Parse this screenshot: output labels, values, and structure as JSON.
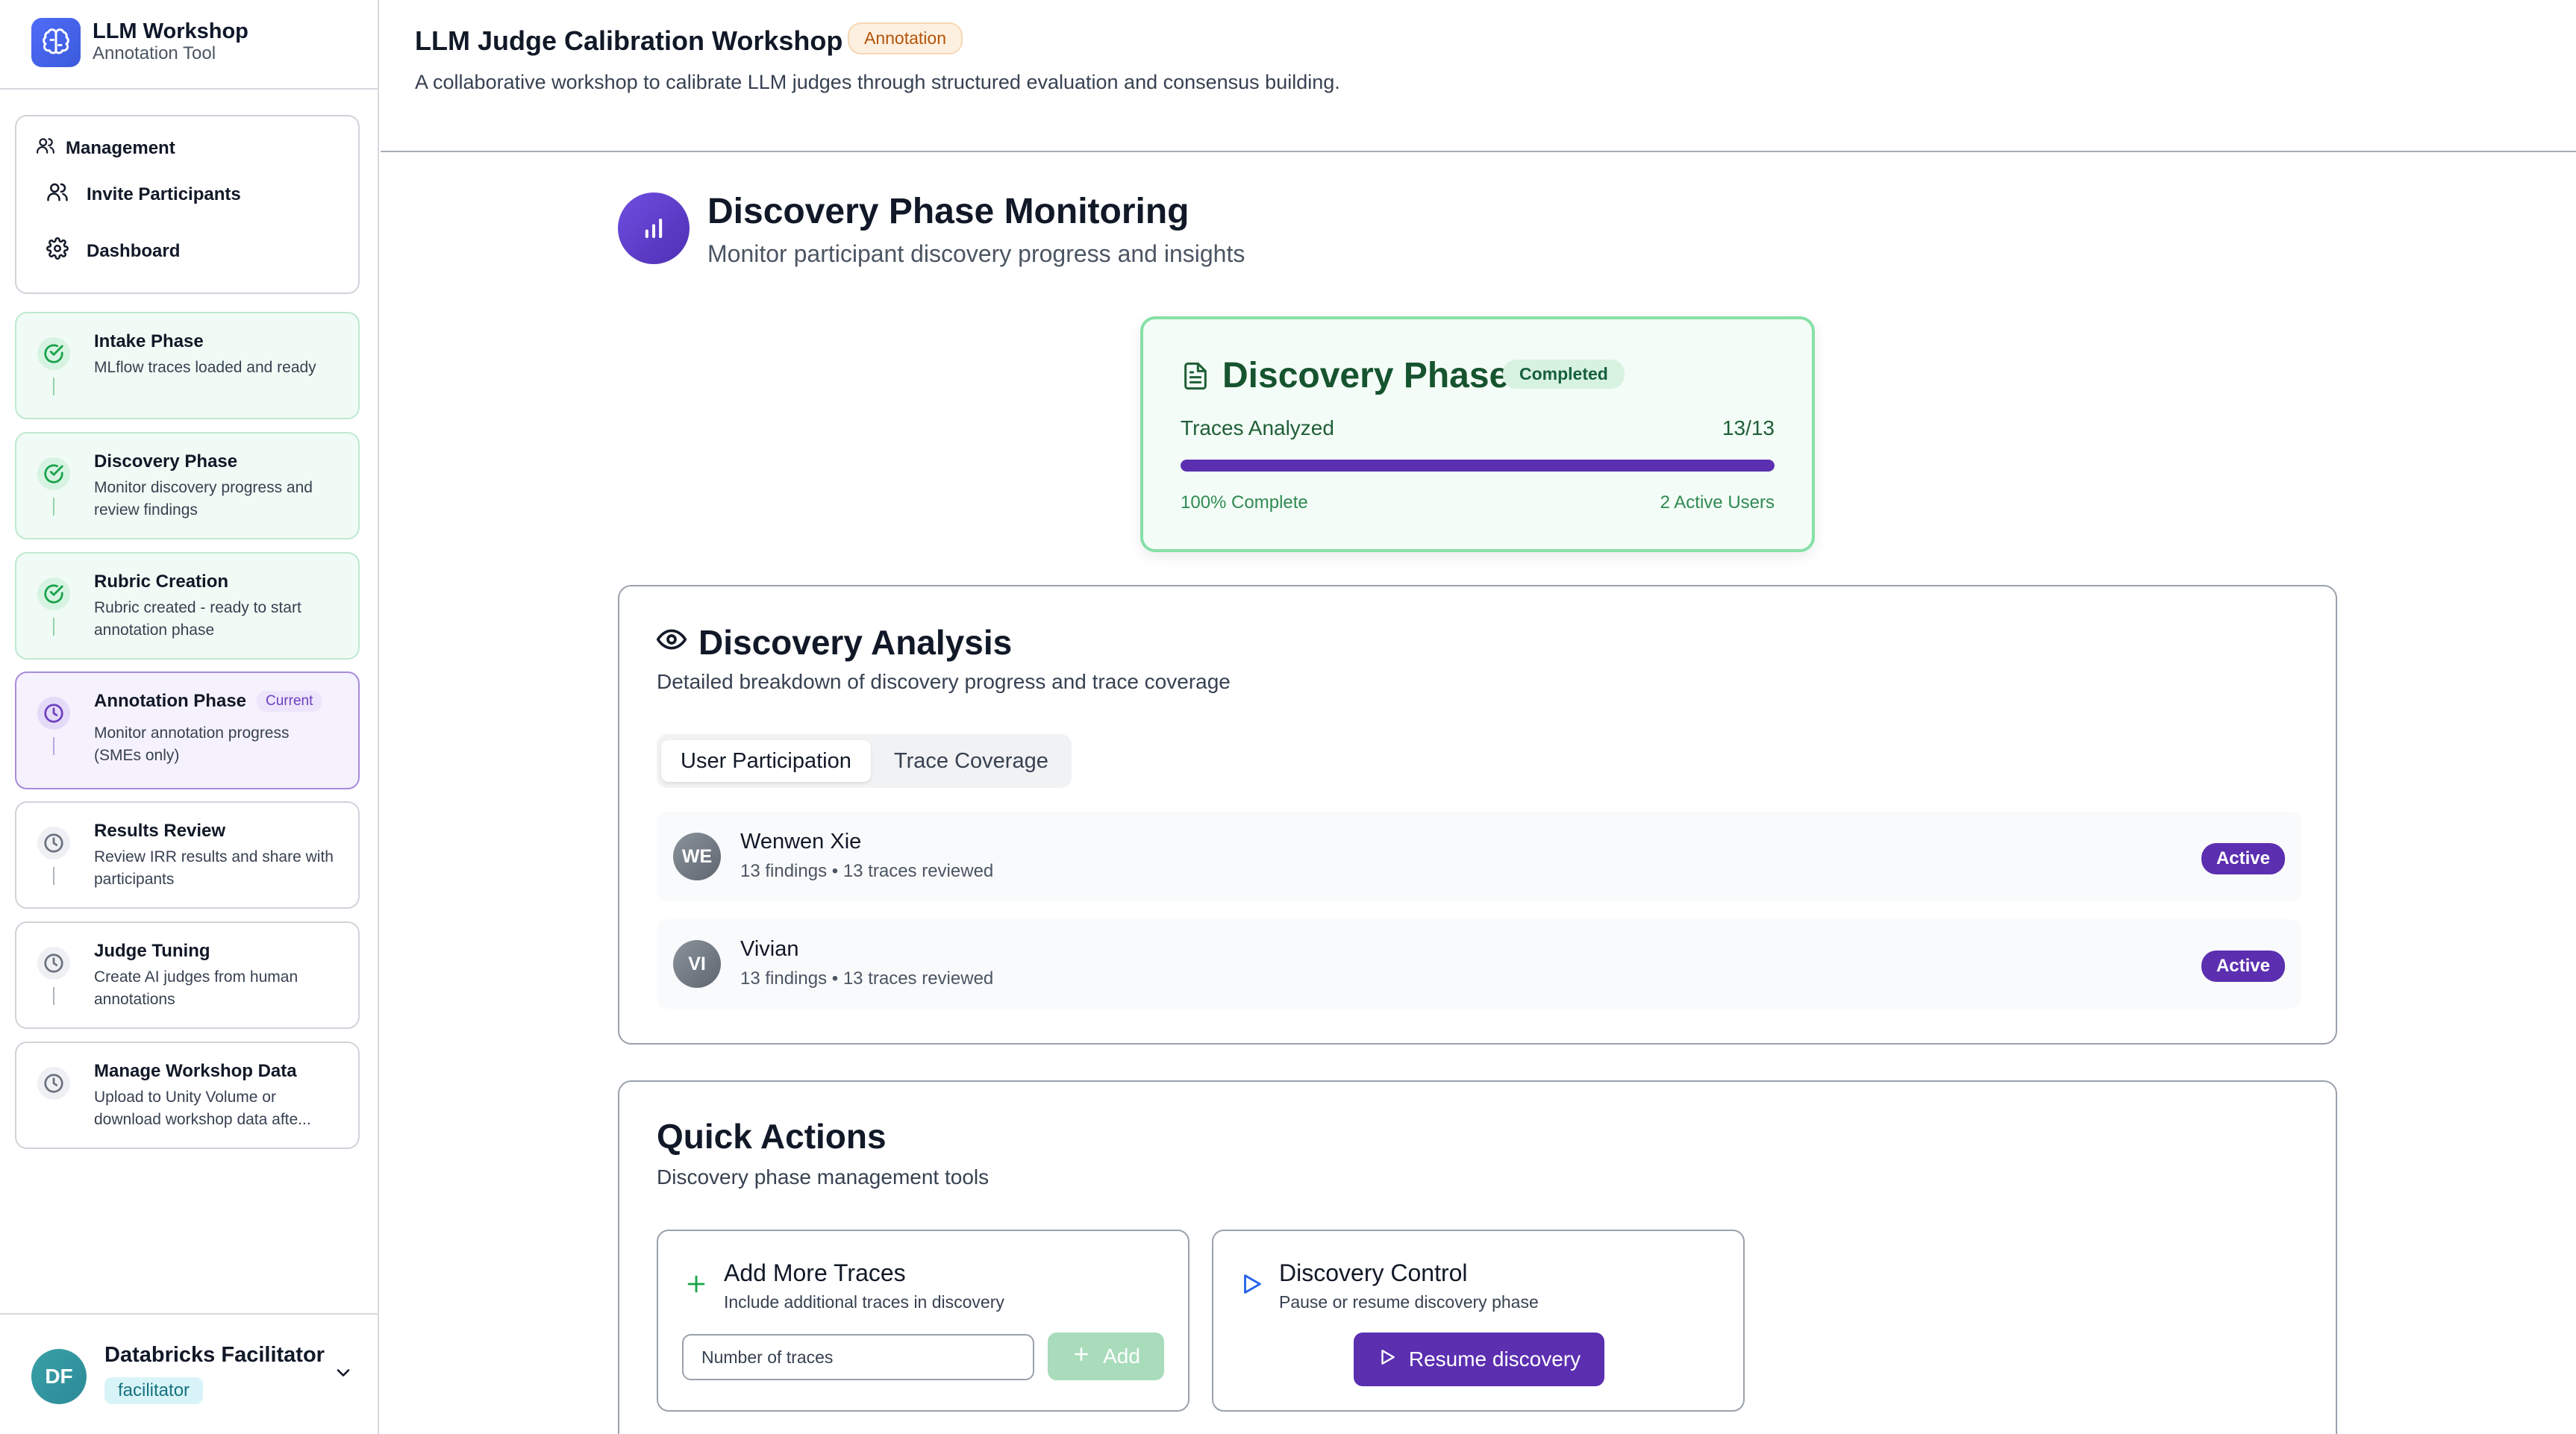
{
  "brand": {
    "title": "LLM Workshop",
    "subtitle": "Annotation Tool"
  },
  "management": {
    "heading": "Management",
    "items": [
      {
        "label": "Invite Participants",
        "icon": "users-icon"
      },
      {
        "label": "Dashboard",
        "icon": "gear-icon"
      }
    ]
  },
  "phases": [
    {
      "title": "Intake Phase",
      "desc": "MLflow traces loaded and ready",
      "status": "done"
    },
    {
      "title": "Discovery Phase",
      "desc": "Monitor discovery progress and review findings",
      "status": "done"
    },
    {
      "title": "Rubric Creation",
      "desc": "Rubric created - ready to start annotation phase",
      "status": "done"
    },
    {
      "title": "Annotation Phase",
      "badge": "Current",
      "desc": "Monitor annotation progress (SMEs only)",
      "status": "current"
    },
    {
      "title": "Results Review",
      "desc": "Review IRR results and share with participants",
      "status": "todo"
    },
    {
      "title": "Judge Tuning",
      "desc": "Create AI judges from human annotations",
      "status": "todo"
    },
    {
      "title": "Manage Workshop Data",
      "desc": "Upload to Unity Volume or download workshop data afte...",
      "status": "todo"
    }
  ],
  "user": {
    "initials": "DF",
    "name": "Databricks Facilitator",
    "role": "facilitator"
  },
  "header": {
    "title": "LLM Judge Calibration Workshop",
    "badge": "Annotation",
    "description": "A collaborative workshop to calibrate LLM judges through structured evaluation and consensus building."
  },
  "monitoring": {
    "title": "Discovery Phase Monitoring",
    "subtitle": "Monitor participant discovery progress and insights"
  },
  "discovery_card": {
    "title": "Discovery Phase",
    "badge": "Completed",
    "label": "Traces Analyzed",
    "count": "13/13",
    "progress": 1.0,
    "percent_text": "100% Complete",
    "active_users": "2 Active Users"
  },
  "analysis": {
    "title": "Discovery Analysis",
    "subtitle": "Detailed breakdown of discovery progress and trace coverage",
    "tabs": [
      {
        "label": "User Participation",
        "active": true
      },
      {
        "label": "Trace Coverage",
        "active": false
      }
    ],
    "users": [
      {
        "initials": "WE",
        "name": "Wenwen Xie",
        "stats": "13 findings • 13 traces reviewed",
        "status": "Active"
      },
      {
        "initials": "VI",
        "name": "Vivian",
        "stats": "13 findings • 13 traces reviewed",
        "status": "Active"
      }
    ]
  },
  "quick_actions": {
    "title": "Quick Actions",
    "subtitle": "Discovery phase management tools",
    "add_traces": {
      "title": "Add More Traces",
      "subtitle": "Include additional traces in discovery",
      "placeholder": "Number of traces",
      "button": "Add"
    },
    "control": {
      "title": "Discovery Control",
      "subtitle": "Pause or resume discovery phase",
      "button": "Resume discovery"
    }
  },
  "colors": {
    "accent": "#5b2fb0",
    "success": "#86e0a6",
    "annotation_badge": "#b45309"
  }
}
